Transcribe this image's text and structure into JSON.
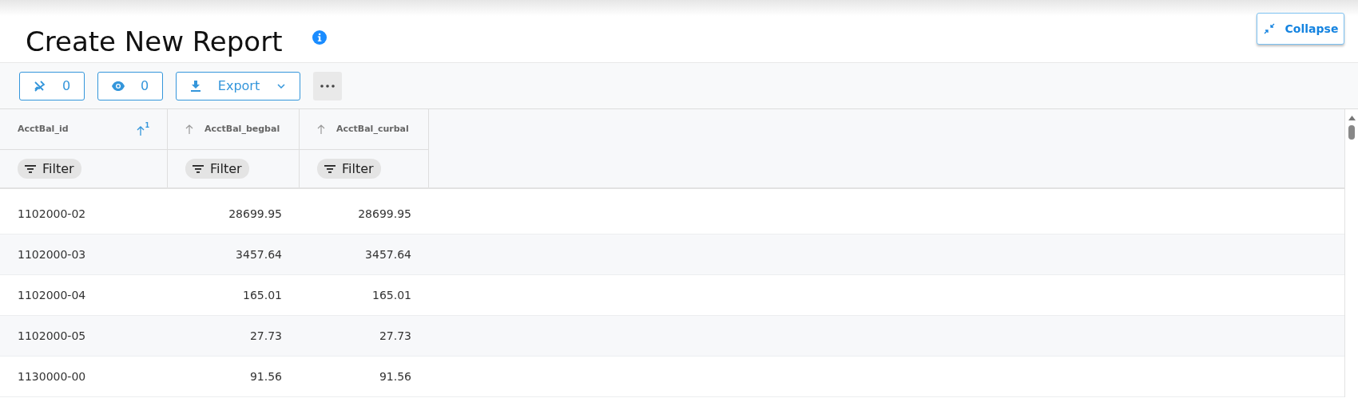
{
  "header": {
    "title": "Create New Report",
    "collapse_button": "Collapse"
  },
  "toolbar": {
    "pinned_count": "0",
    "visible_count": "0",
    "export_button": "Export"
  },
  "table": {
    "columns": [
      {
        "label": "AcctBal_id",
        "sorted": true,
        "sort_order": "1",
        "kind": "text",
        "filter": "Filter"
      },
      {
        "label": "AcctBal_begbal",
        "sorted": false,
        "kind": "number",
        "filter": "Filter"
      },
      {
        "label": "AcctBal_curbal",
        "sorted": false,
        "kind": "number",
        "filter": "Filter"
      }
    ],
    "rows": [
      [
        "1102000-02",
        "28699.95",
        "28699.95"
      ],
      [
        "1102000-03",
        "3457.64",
        "3457.64"
      ],
      [
        "1102000-04",
        "165.01",
        "165.01"
      ],
      [
        "1102000-05",
        "27.73",
        "27.73"
      ],
      [
        "1130000-00",
        "91.56",
        "91.56"
      ]
    ]
  }
}
